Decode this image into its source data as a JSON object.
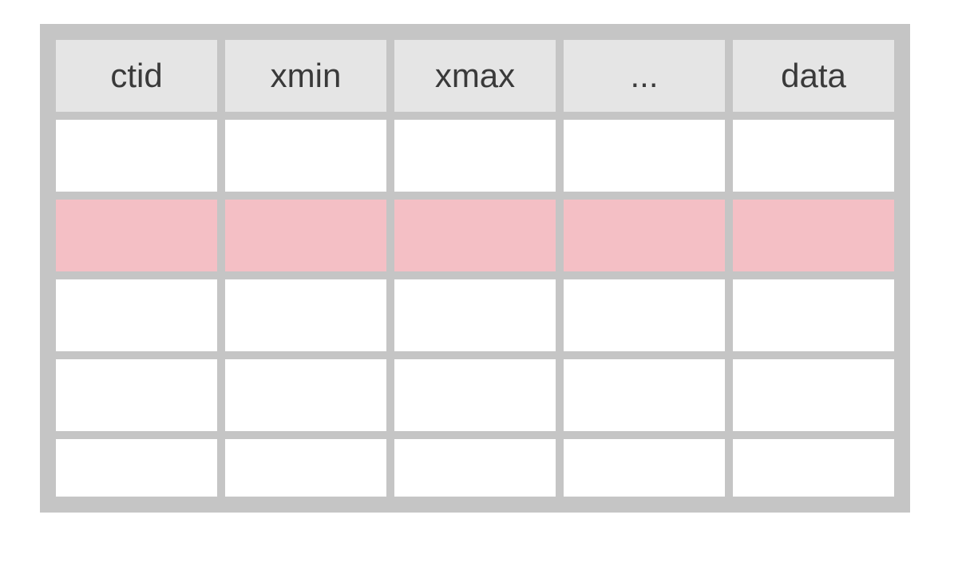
{
  "table": {
    "headers": [
      "ctid",
      "xmin",
      "xmax",
      "...",
      "data"
    ],
    "rows": [
      {
        "highlight": false,
        "short": false,
        "cells": [
          "",
          "",
          "",
          "",
          ""
        ]
      },
      {
        "highlight": true,
        "short": false,
        "cells": [
          "",
          "",
          "",
          "",
          ""
        ]
      },
      {
        "highlight": false,
        "short": false,
        "cells": [
          "",
          "",
          "",
          "",
          ""
        ]
      },
      {
        "highlight": false,
        "short": false,
        "cells": [
          "",
          "",
          "",
          "",
          ""
        ]
      },
      {
        "highlight": false,
        "short": true,
        "cells": [
          "",
          "",
          "",
          "",
          ""
        ]
      }
    ]
  },
  "colors": {
    "border": "#c5c5c5",
    "header_bg": "#e5e5e5",
    "header_fg": "#3a3a3a",
    "cell_bg": "#ffffff",
    "highlight_bg": "#f4bfc5"
  }
}
